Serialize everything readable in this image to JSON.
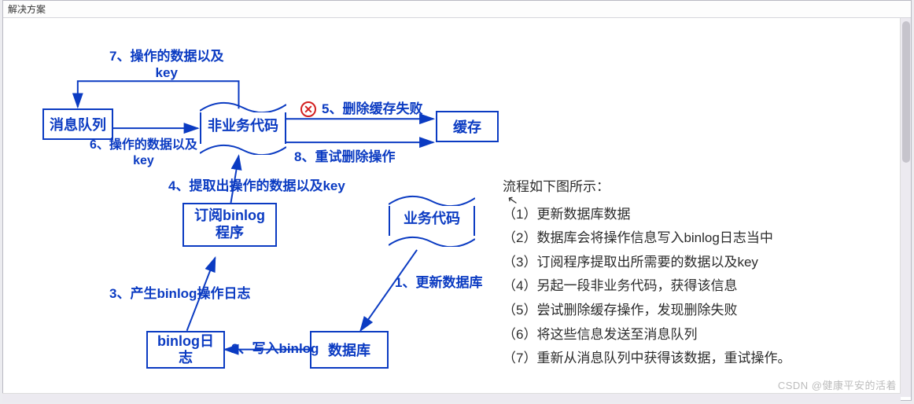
{
  "window": {
    "title": "解决方案"
  },
  "nodes": {
    "mq": "消息队列",
    "nonbiz": "非业务代码",
    "cache": "缓存",
    "sub": "订阅binlog\n程序",
    "bizcode": "业务代码",
    "binlog": "binlog日\n志",
    "db": "数据库"
  },
  "edges": {
    "e7": "7、操作的数据以及\nkey",
    "e6": "6、操作的数据以及\nkey",
    "e5": "5、删除缓存失败",
    "e8": "8、重试删除操作",
    "e4": "4、提取出操作的数据以及key",
    "e3": "3、产生binlog操作日志",
    "e2": "2、写入binlog",
    "e1": "1、更新数据库"
  },
  "error_icon": "✕",
  "steps": {
    "header": "流程如下图所示：",
    "items": [
      "（1）更新数据库数据",
      "（2）数据库会将操作信息写入binlog日志当中",
      "（3）订阅程序提取出所需要的数据以及key",
      "（4）另起一段非业务代码，获得该信息",
      "（5）尝试删除缓存操作，发现删除失败",
      "（6）将这些信息发送至消息队列",
      "（7）重新从消息队列中获得该数据，重试操作。"
    ]
  },
  "watermark": "CSDN @健康平安的活着"
}
